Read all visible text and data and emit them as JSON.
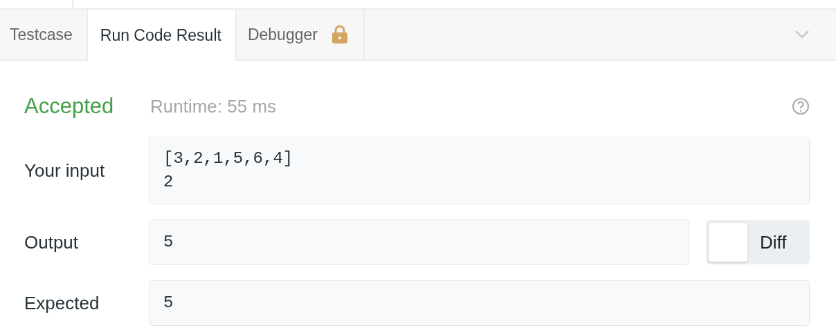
{
  "tabs": [
    {
      "label": "Testcase",
      "selected": false,
      "locked": false
    },
    {
      "label": "Run Code Result",
      "selected": true,
      "locked": false
    },
    {
      "label": "Debugger",
      "selected": false,
      "locked": true
    }
  ],
  "result": {
    "status": "Accepted",
    "runtime": "Runtime: 55 ms"
  },
  "rows": [
    {
      "label": "Your input",
      "lines": [
        "[3,2,1,5,6,4]",
        "2"
      ]
    },
    {
      "label": "Output",
      "lines": [
        "5"
      ],
      "diff": {
        "label": "Diff",
        "on": false
      }
    },
    {
      "label": "Expected",
      "lines": [
        "5"
      ]
    }
  ]
}
